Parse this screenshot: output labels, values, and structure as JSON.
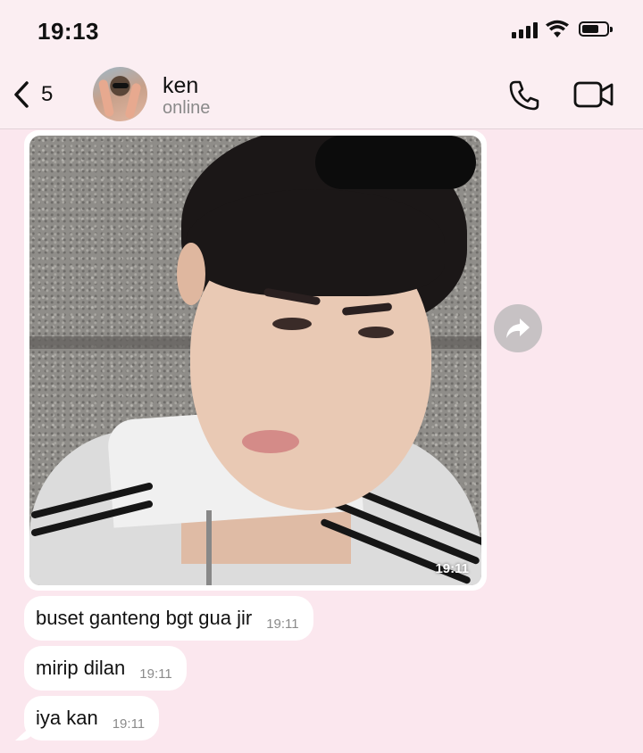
{
  "status_bar": {
    "time": "19:13",
    "battery_level": 0.7
  },
  "header": {
    "back_count": "5",
    "contact_name": "ken",
    "contact_status": "online",
    "icons": [
      "back-chevron-icon",
      "phone-icon",
      "video-camera-icon"
    ]
  },
  "messages": [
    {
      "type": "image",
      "time": "19:11",
      "description_icon": "photo"
    },
    {
      "type": "text",
      "text": "buset ganteng bgt gua jir",
      "time": "19:11"
    },
    {
      "type": "text",
      "text": "mirip dilan",
      "time": "19:11"
    },
    {
      "type": "text",
      "text": "iya kan",
      "time": "19:11"
    }
  ],
  "colors": {
    "background": "#fbe7ee",
    "bubble": "#ffffff",
    "accent": "#111111",
    "forward_button": "#c7c2c4"
  }
}
